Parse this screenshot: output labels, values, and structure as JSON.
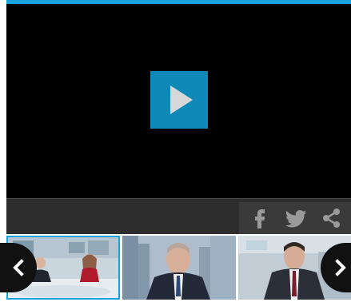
{
  "player": {
    "play_icon": "play-icon",
    "accent_color": "#1aa3dc",
    "play_button_color": "#0f8ab8"
  },
  "share": {
    "icons": [
      "facebook-icon",
      "twitter-icon",
      "share-icon"
    ],
    "bar_color": "#2d2d2d"
  },
  "carousel": {
    "prev_icon": "chevron-left-icon",
    "next_icon": "chevron-right-icon",
    "thumbnails": [
      {
        "name": "news-studio-thumbnail-1",
        "active": true
      },
      {
        "name": "news-anchor-thumbnail-2",
        "active": false
      },
      {
        "name": "news-anchor-thumbnail-3",
        "active": false
      }
    ]
  }
}
